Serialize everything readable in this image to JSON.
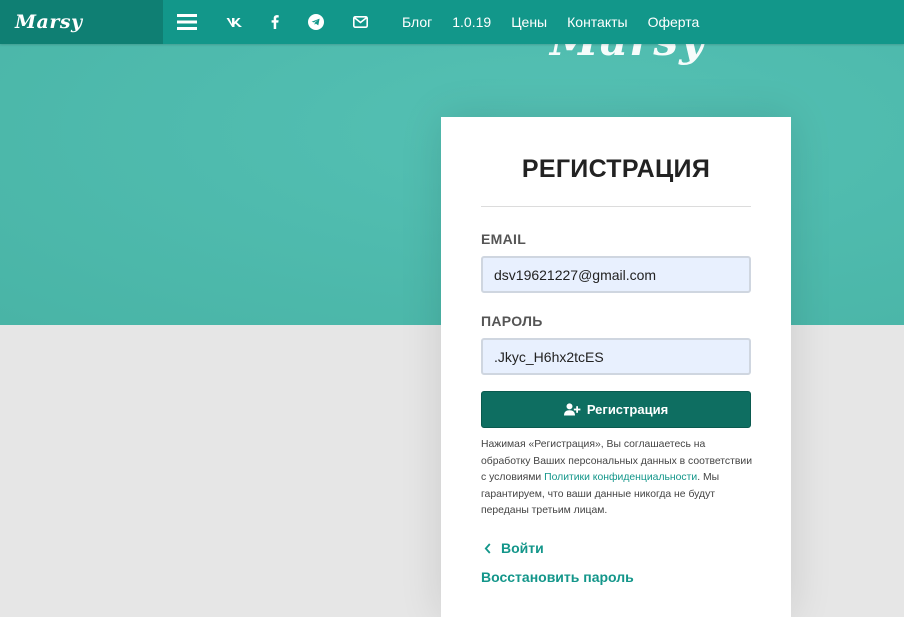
{
  "brand": {
    "logo_text": "Marsy"
  },
  "hero": {
    "logo_text": "Marsy"
  },
  "nav": {
    "icons": [
      "menu-icon",
      "vk-icon",
      "facebook-icon",
      "telegram-icon",
      "mail-icon"
    ],
    "links": [
      "Блог",
      "1.0.19",
      "Цены",
      "Контакты",
      "Оферта"
    ]
  },
  "form": {
    "title": "РЕГИСТРАЦИЯ",
    "email_label": "EMAIL",
    "email_value": "dsv19621227@gmail.com",
    "password_label": "ПАРОЛЬ",
    "password_value": ".Jkyc_H6hx2tcES",
    "submit_label": "Регистрация",
    "consent_before": "Нажимая «Регистрация», Вы соглашаетесь на обработку Ваших персональных данных в соответствии с условиями ",
    "consent_link": "Политики конфиденциальности",
    "consent_after": ". Мы гарантируем, что ваши данные никогда не будут переданы третьим лицам.",
    "login_link": "Войти",
    "restore_link": "Восстановить пароль"
  },
  "colors": {
    "topbar": "#12978a",
    "brand_bg": "#0f7f73",
    "hero": "#4fbbae",
    "button": "#0e6e61",
    "link": "#13968a",
    "input_bg": "#e8f0fe"
  }
}
